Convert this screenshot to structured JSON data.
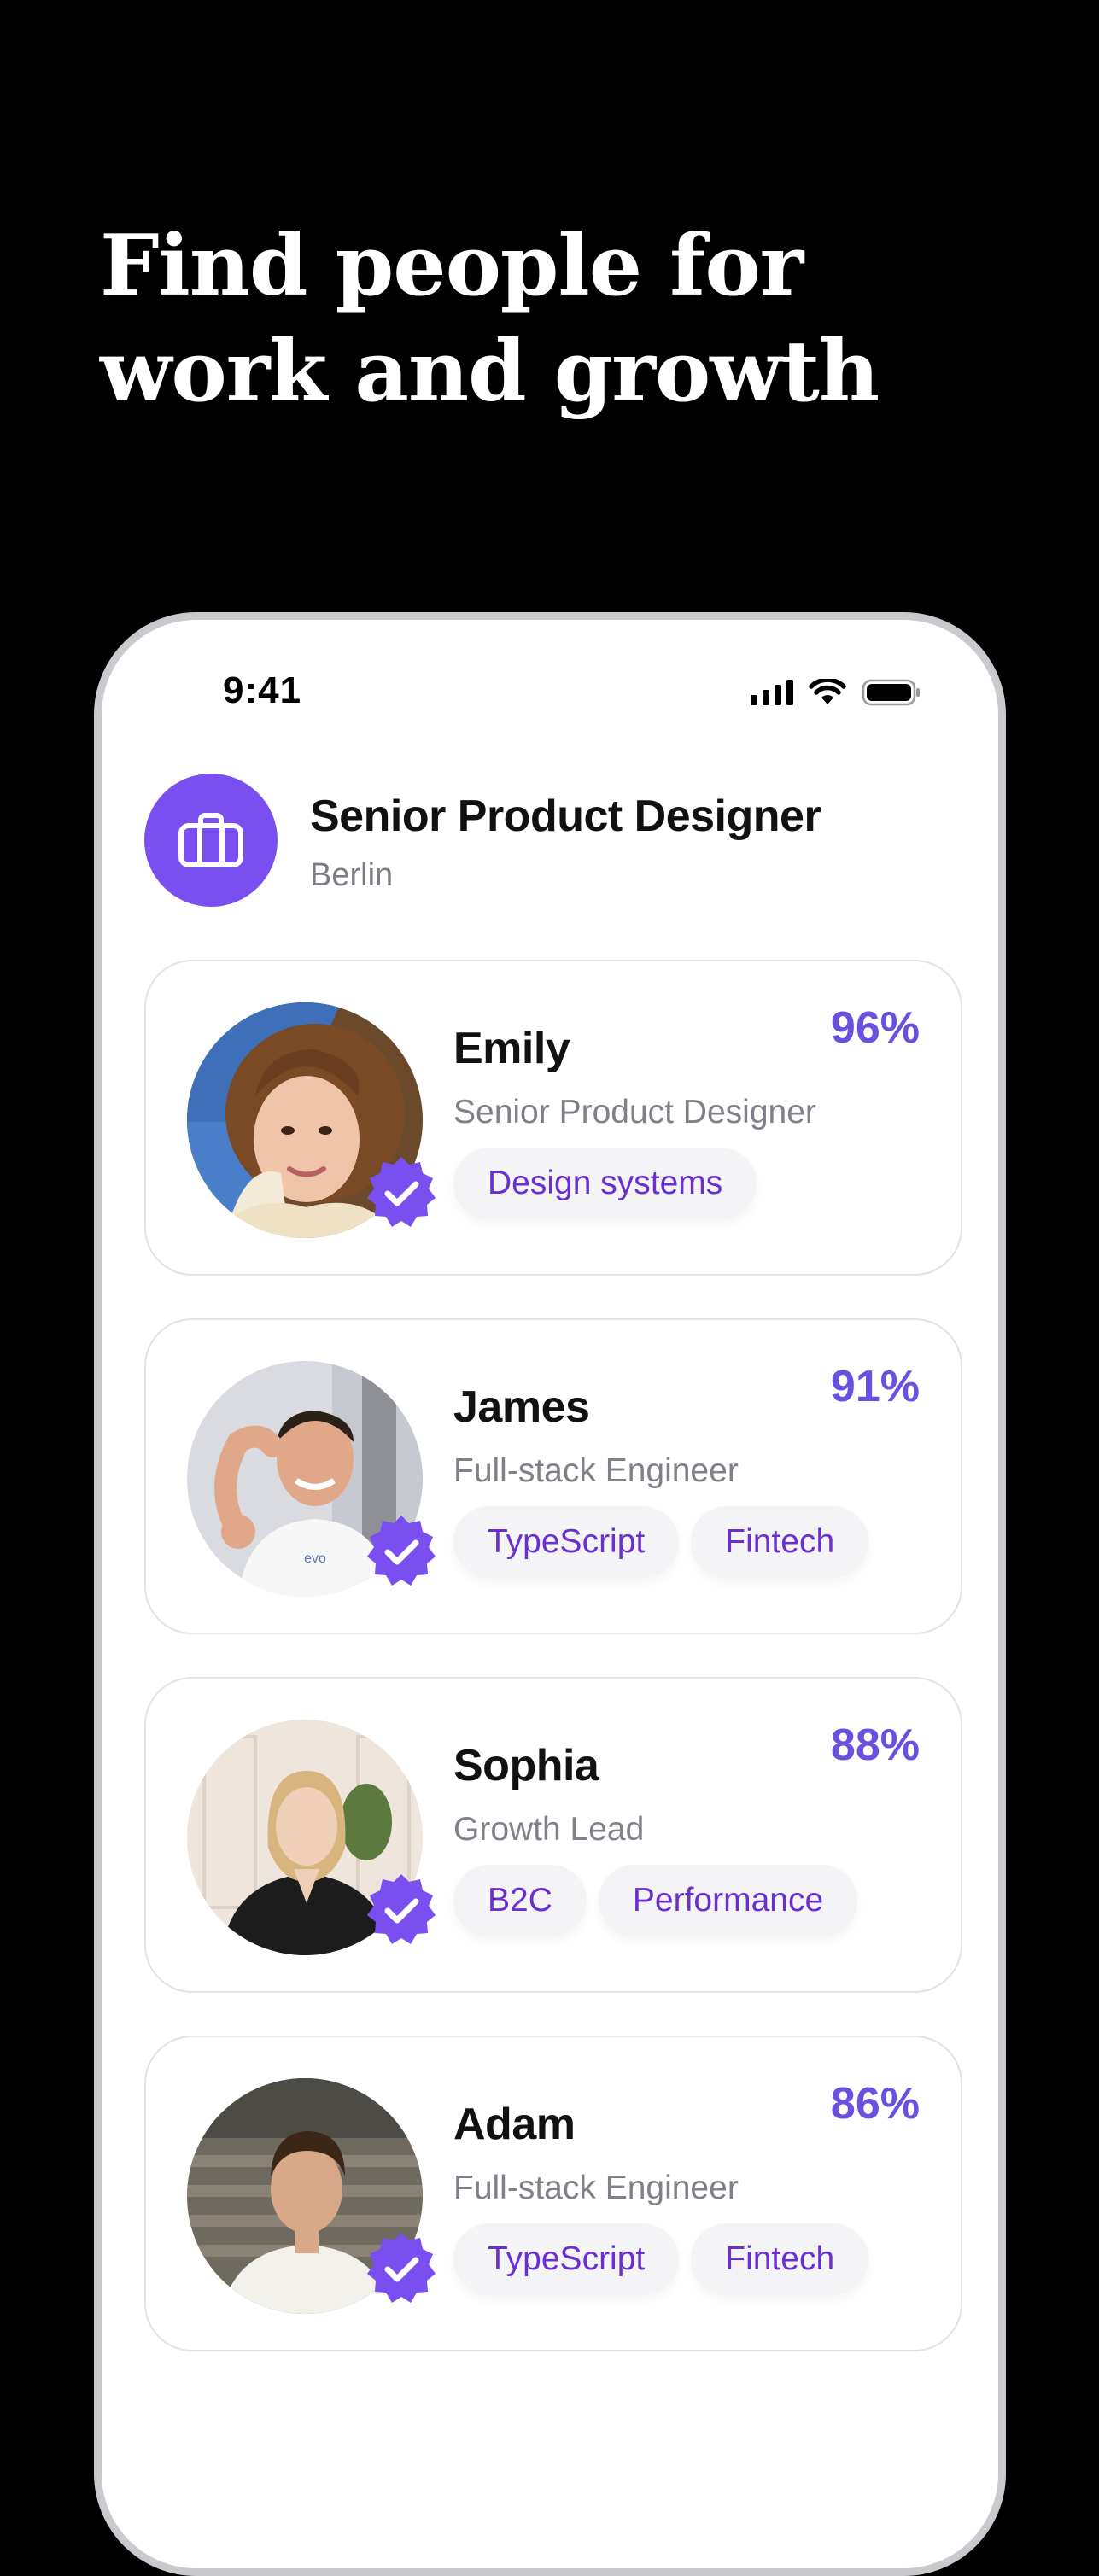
{
  "headline": "Find people for work and growth",
  "status_bar": {
    "time": "9:41"
  },
  "job": {
    "title": "Senior Product Designer",
    "location": "Berlin"
  },
  "candidates": [
    {
      "name": "Emily",
      "role": "Senior Product Designer",
      "match": "96%",
      "tags": [
        "Design systems"
      ]
    },
    {
      "name": "James",
      "role": "Full-stack Engineer",
      "match": "91%",
      "tags": [
        "TypeScript",
        "Fintech"
      ]
    },
    {
      "name": "Sophia",
      "role": "Growth Lead",
      "match": "88%",
      "tags": [
        "B2C",
        "Performance"
      ]
    },
    {
      "name": "Adam",
      "role": "Full-stack Engineer",
      "match": "86%",
      "tags": [
        "TypeScript",
        "Fintech"
      ]
    }
  ],
  "colors": {
    "accent": "#7a4fef",
    "match": "#6a4fe0",
    "tag_text": "#6a2fd0"
  }
}
